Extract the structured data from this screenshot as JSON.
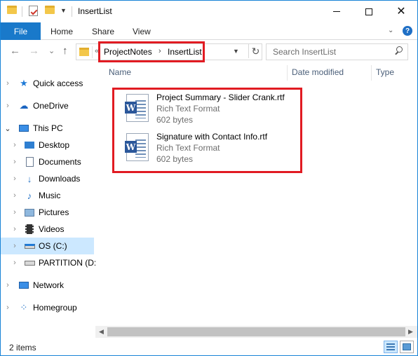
{
  "window": {
    "title": "InsertList",
    "controls": {
      "minimize_icon": "minimize-icon",
      "maximize_icon": "maximize-icon",
      "close_icon": "close-icon"
    }
  },
  "ribbon": {
    "tabs": [
      {
        "label": "File"
      },
      {
        "label": "Home"
      },
      {
        "label": "Share"
      },
      {
        "label": "View"
      }
    ],
    "help_glyph": "?",
    "expand_glyph": "⌄"
  },
  "navigation": {
    "back_glyph": "←",
    "forward_glyph": "→",
    "recent_glyph": "⌄",
    "up_glyph": "↑",
    "refresh_glyph": "↻"
  },
  "address": {
    "overflow": "«",
    "crumbs": [
      "ProjectNotes",
      "InsertList"
    ],
    "separator": "›"
  },
  "search": {
    "placeholder": "Search InsertList"
  },
  "sidebar": {
    "items": [
      {
        "label": "Quick access",
        "icon": "star-icon"
      },
      {
        "label": "OneDrive",
        "icon": "cloud-icon"
      },
      {
        "label": "This PC",
        "icon": "computer-icon"
      },
      {
        "label": "Desktop",
        "icon": "desktop-icon"
      },
      {
        "label": "Documents",
        "icon": "documents-icon"
      },
      {
        "label": "Downloads",
        "icon": "download-icon"
      },
      {
        "label": "Music",
        "icon": "music-icon"
      },
      {
        "label": "Pictures",
        "icon": "pictures-icon"
      },
      {
        "label": "Videos",
        "icon": "videos-icon"
      },
      {
        "label": "OS (C:)",
        "icon": "drive-icon"
      },
      {
        "label": "PARTITION (D:)",
        "icon": "drive-icon"
      },
      {
        "label": "Network",
        "icon": "network-icon"
      },
      {
        "label": "Homegroup",
        "icon": "homegroup-icon"
      }
    ],
    "selected": "OS (C:)"
  },
  "columns": [
    "Name",
    "Date modified",
    "Type"
  ],
  "files": [
    {
      "name": "Project Summary - Slider Crank.rtf",
      "type": "Rich Text Format",
      "size": "602 bytes",
      "icon": "word-document-icon"
    },
    {
      "name": "Signature with Contact Info.rtf",
      "type": "Rich Text Format",
      "size": "602 bytes",
      "icon": "word-document-icon"
    }
  ],
  "status": {
    "item_count": "2 items"
  },
  "colors": {
    "accent": "#1979ca",
    "selection": "#cce8ff",
    "highlight": "#e11b22"
  }
}
